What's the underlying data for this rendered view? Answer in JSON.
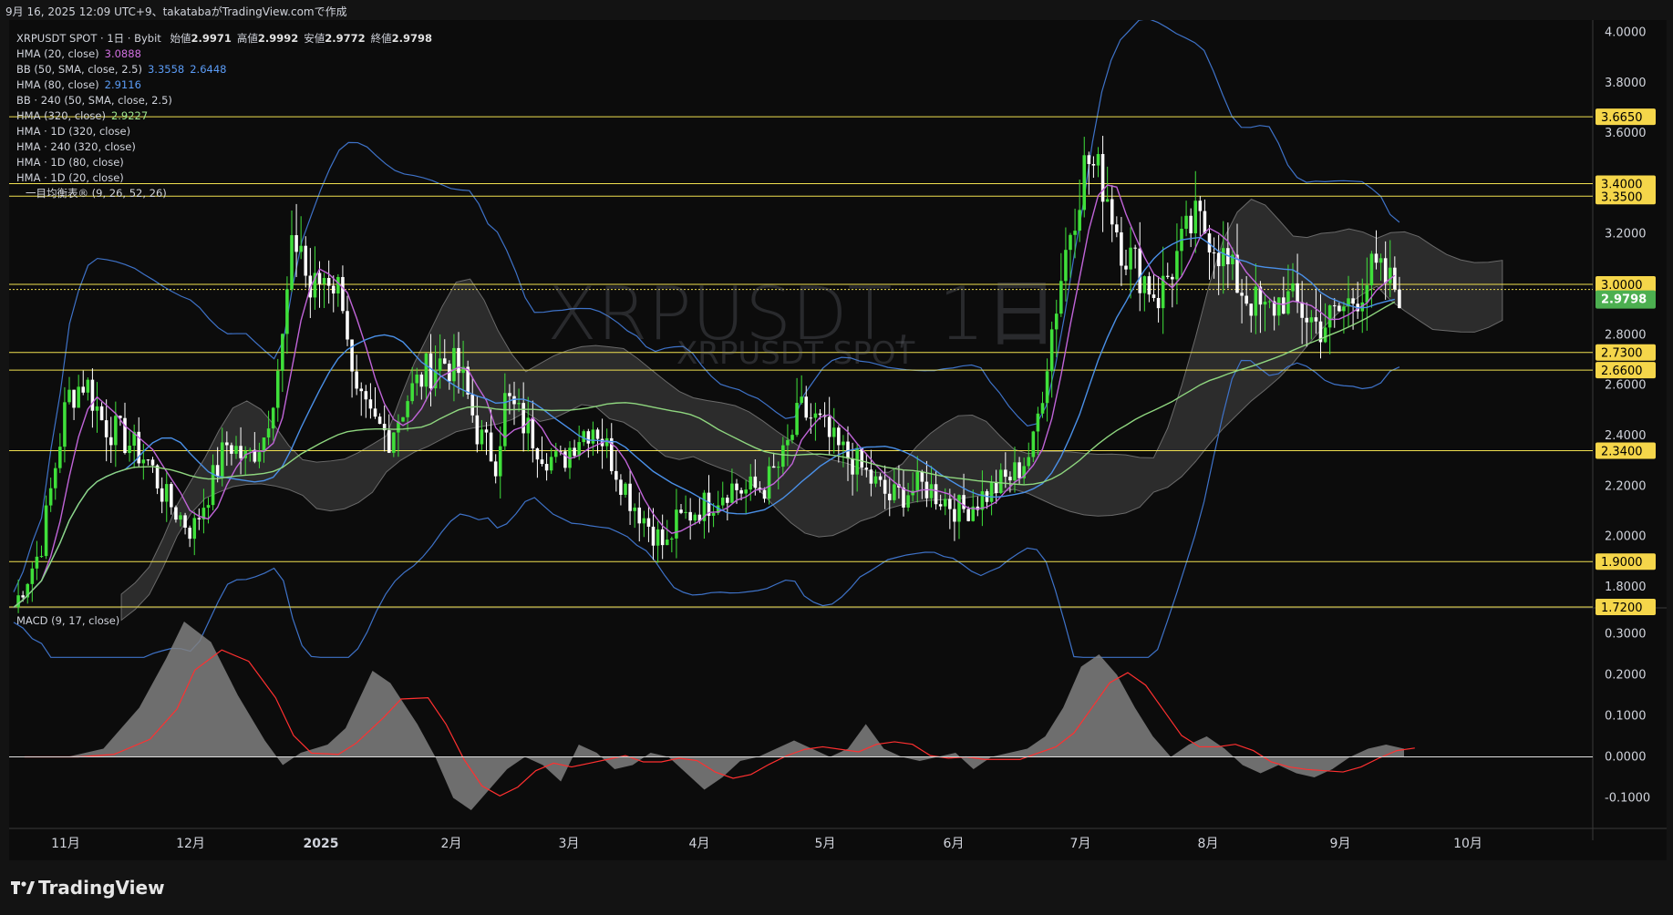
{
  "caption": "9月 16, 2025 12:09 UTC+9、takatabaがTradingView.comで作成",
  "header": {
    "symbol_line_prefix": "XRPUSDT SPOT · 1日 · Bybit",
    "ohlc": [
      {
        "label": "始値",
        "value": "2.9971"
      },
      {
        "label": "高値",
        "value": "2.9992"
      },
      {
        "label": "安値",
        "value": "2.9772"
      },
      {
        "label": "終値",
        "value": "2.9798"
      }
    ]
  },
  "indicators": [
    {
      "label": "HMA (20, close)",
      "value": "3.0888",
      "value_color": "#d070e0"
    },
    {
      "label": "BB (50, SMA, close, 2.5)",
      "value": "3.3558",
      "value_color": "#5b9cf6",
      "value2": "2.6448",
      "value2_color": "#5b9cf6"
    },
    {
      "label": "HMA (80, close)",
      "value": "2.9116",
      "value_color": "#5b9cf6"
    },
    {
      "label": "BB · 240 (50, SMA, close, 2.5)"
    },
    {
      "label": "HMA (320, close)",
      "value": "2.9227",
      "value_color": "#9ee68f"
    },
    {
      "label": "HMA · 1D (320, close)"
    },
    {
      "label": "HMA · 240 (320, close)"
    },
    {
      "label": "HMA · 1D (80, close)"
    },
    {
      "label": "HMA · 1D (20, close)"
    },
    {
      "label": "一目均衡表® (9, 26, 52, 26)"
    }
  ],
  "watermark": {
    "title": "XRPUSDT, 1日",
    "subtitle": "XRPUSDT SPOT"
  },
  "macd_label": "MACD (9, 17, close)",
  "brand": "TradingView",
  "colors": {
    "up": "#3fe03a",
    "down": "#ffffff",
    "hma20": "#c064d8",
    "hma80": "#4a90e8",
    "bb": "#3e72c8",
    "hma320": "#8fd67f",
    "level": "#f0e050",
    "cloud": "#5a5a5a",
    "macd_hist": "#808080",
    "macd_signal": "#ff3030",
    "price_label": "#4caf50"
  },
  "chart_data": [
    {
      "type": "candlestick",
      "title": "XRPUSDT, 1日",
      "x_labels": [
        "11月",
        "12月",
        "2025",
        "2月",
        "3月",
        "4月",
        "5月",
        "6月",
        "7月",
        "8月",
        "9月",
        "10月"
      ],
      "y_ticks": [
        "4.0000",
        "3.8000",
        "3.6000",
        "3.2000",
        "2.8000",
        "2.6000",
        "2.4000",
        "2.2000",
        "2.0000",
        "1.8000"
      ],
      "ylim": [
        1.72,
        4.02
      ],
      "levels": [
        "3.6650",
        "3.4000",
        "3.3500",
        "3.0000",
        "2.7300",
        "2.6600",
        "2.3400",
        "1.9000",
        "1.7200"
      ],
      "current_price": "2.9798",
      "close_path": [
        [
          0,
          1.72
        ],
        [
          3,
          1.95
        ],
        [
          6,
          2.55
        ],
        [
          8,
          2.62
        ],
        [
          10,
          2.45
        ],
        [
          12,
          2.4
        ],
        [
          15,
          2.3
        ],
        [
          17,
          2.15
        ],
        [
          20,
          2.02
        ],
        [
          22,
          2.2
        ],
        [
          24,
          2.38
        ],
        [
          26,
          2.3
        ],
        [
          28,
          2.4
        ],
        [
          30,
          2.75
        ],
        [
          31,
          3.1
        ],
        [
          32,
          3.2
        ],
        [
          33,
          2.95
        ],
        [
          35,
          3.05
        ],
        [
          37,
          2.95
        ],
        [
          38,
          2.55
        ],
        [
          40,
          2.45
        ],
        [
          42,
          2.4
        ],
        [
          44,
          2.55
        ],
        [
          46,
          2.65
        ],
        [
          48,
          2.7
        ],
        [
          50,
          2.65
        ],
        [
          52,
          2.4
        ],
        [
          54,
          2.3
        ],
        [
          55,
          2.55
        ],
        [
          57,
          2.45
        ],
        [
          59,
          2.35
        ],
        [
          61,
          2.28
        ],
        [
          63,
          2.4
        ],
        [
          65,
          2.45
        ],
        [
          67,
          2.3
        ],
        [
          69,
          2.15
        ],
        [
          71,
          2.05
        ],
        [
          73,
          1.95
        ],
        [
          74,
          2.05
        ],
        [
          76,
          2.1
        ],
        [
          78,
          2.14
        ],
        [
          80,
          2.2
        ],
        [
          82,
          2.18
        ],
        [
          84,
          2.2
        ],
        [
          86,
          2.3
        ],
        [
          88,
          2.5
        ],
        [
          90,
          2.45
        ],
        [
          92,
          2.35
        ],
        [
          94,
          2.3
        ],
        [
          96,
          2.22
        ],
        [
          98,
          2.15
        ],
        [
          100,
          2.18
        ],
        [
          102,
          2.2
        ],
        [
          104,
          2.15
        ],
        [
          106,
          2.1
        ],
        [
          108,
          2.15
        ],
        [
          110,
          2.2
        ],
        [
          112,
          2.25
        ],
        [
          114,
          2.35
        ],
        [
          116,
          2.8
        ],
        [
          118,
          3.2
        ],
        [
          120,
          3.5
        ],
        [
          122,
          3.4
        ],
        [
          124,
          3.15
        ],
        [
          126,
          3.05
        ],
        [
          128,
          2.95
        ],
        [
          130,
          3.1
        ],
        [
          132,
          3.25
        ],
        [
          134,
          3.2
        ],
        [
          136,
          3.05
        ],
        [
          138,
          2.95
        ],
        [
          140,
          2.88
        ],
        [
          142,
          2.95
        ],
        [
          144,
          2.9
        ],
        [
          146,
          2.83
        ],
        [
          148,
          2.88
        ],
        [
          150,
          2.95
        ],
        [
          152,
          3.05
        ],
        [
          154,
          3.0
        ],
        [
          155,
          2.98
        ]
      ],
      "series": [
        {
          "name": "HMA (20, close)",
          "current": "3.0888"
        },
        {
          "name": "HMA (80, close)",
          "current": "2.9116"
        },
        {
          "name": "HMA (320, close)",
          "current": "2.9227"
        },
        {
          "name": "BB (50, SMA, close, 2.5)",
          "upper": "3.3558",
          "lower": "2.6448"
        }
      ]
    },
    {
      "type": "area",
      "title": "MACD (9, 17, close)",
      "y_ticks": [
        "0.3000",
        "0.2000",
        "0.1000",
        "0.0000",
        "-0.1000"
      ],
      "ylim": [
        -0.17,
        0.33
      ],
      "hist": [
        [
          0,
          0
        ],
        [
          6,
          0
        ],
        [
          10,
          0.02
        ],
        [
          14,
          0.12
        ],
        [
          17,
          0.24
        ],
        [
          19,
          0.33
        ],
        [
          22,
          0.28
        ],
        [
          25,
          0.15
        ],
        [
          28,
          0.04
        ],
        [
          30,
          -0.02
        ],
        [
          32,
          0.01
        ],
        [
          35,
          0.03
        ],
        [
          37,
          0.07
        ],
        [
          40,
          0.21
        ],
        [
          42,
          0.18
        ],
        [
          45,
          0.08
        ],
        [
          47,
          0
        ],
        [
          49,
          -0.1
        ],
        [
          51,
          -0.13
        ],
        [
          53,
          -0.08
        ],
        [
          55,
          -0.03
        ],
        [
          57,
          0
        ],
        [
          59,
          -0.02
        ],
        [
          61,
          -0.06
        ],
        [
          63,
          0.03
        ],
        [
          65,
          0.01
        ],
        [
          67,
          -0.03
        ],
        [
          69,
          -0.02
        ],
        [
          71,
          0.01
        ],
        [
          73,
          0
        ],
        [
          75,
          -0.04
        ],
        [
          77,
          -0.08
        ],
        [
          79,
          -0.05
        ],
        [
          81,
          -0.01
        ],
        [
          83,
          0
        ],
        [
          85,
          0.02
        ],
        [
          87,
          0.04
        ],
        [
          89,
          0.02
        ],
        [
          91,
          0
        ],
        [
          93,
          0.02
        ],
        [
          95,
          0.08
        ],
        [
          97,
          0.02
        ],
        [
          99,
          0
        ],
        [
          101,
          -0.01
        ],
        [
          103,
          0
        ],
        [
          105,
          0.01
        ],
        [
          107,
          -0.03
        ],
        [
          109,
          0
        ],
        [
          111,
          0.01
        ],
        [
          113,
          0.02
        ],
        [
          115,
          0.05
        ],
        [
          117,
          0.12
        ],
        [
          119,
          0.22
        ],
        [
          121,
          0.25
        ],
        [
          123,
          0.2
        ],
        [
          125,
          0.12
        ],
        [
          127,
          0.05
        ],
        [
          129,
          0
        ],
        [
          131,
          0.03
        ],
        [
          133,
          0.05
        ],
        [
          135,
          0.02
        ],
        [
          137,
          -0.02
        ],
        [
          139,
          -0.04
        ],
        [
          141,
          -0.02
        ],
        [
          143,
          -0.04
        ],
        [
          145,
          -0.05
        ],
        [
          147,
          -0.03
        ],
        [
          149,
          0
        ],
        [
          151,
          0.02
        ],
        [
          153,
          0.03
        ],
        [
          155,
          0.02
        ]
      ]
    }
  ]
}
